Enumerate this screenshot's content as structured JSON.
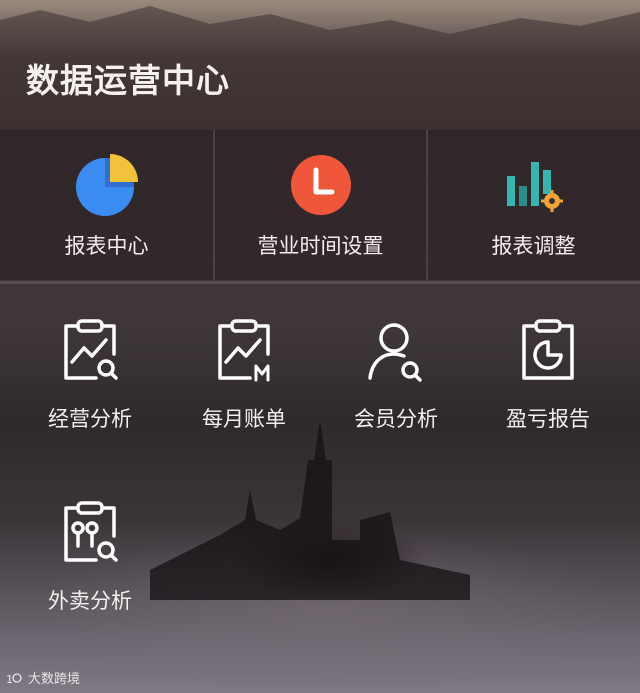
{
  "header": {
    "title": "数据运营中心"
  },
  "top_tiles": [
    {
      "label": "报表中心",
      "icon": "pie-chart-icon",
      "color": "#3b8cf2",
      "accent": "#f2c23a"
    },
    {
      "label": "营业时间设置",
      "icon": "clock-icon",
      "color": "#f0563a"
    },
    {
      "label": "报表调整",
      "icon": "bar-settings-icon",
      "color": "#35b6b0",
      "accent": "#f2a533"
    }
  ],
  "tools": [
    {
      "label": "经营分析",
      "icon": "clipboard-trend-search-icon"
    },
    {
      "label": "每月账单",
      "icon": "clipboard-trend-month-icon",
      "badge": "M"
    },
    {
      "label": "会员分析",
      "icon": "user-search-icon"
    },
    {
      "label": "盈亏报告",
      "icon": "clipboard-pie-icon"
    },
    {
      "label": "外卖分析",
      "icon": "clipboard-pin-search-icon"
    }
  ],
  "watermark": {
    "text": "大数跨境"
  }
}
